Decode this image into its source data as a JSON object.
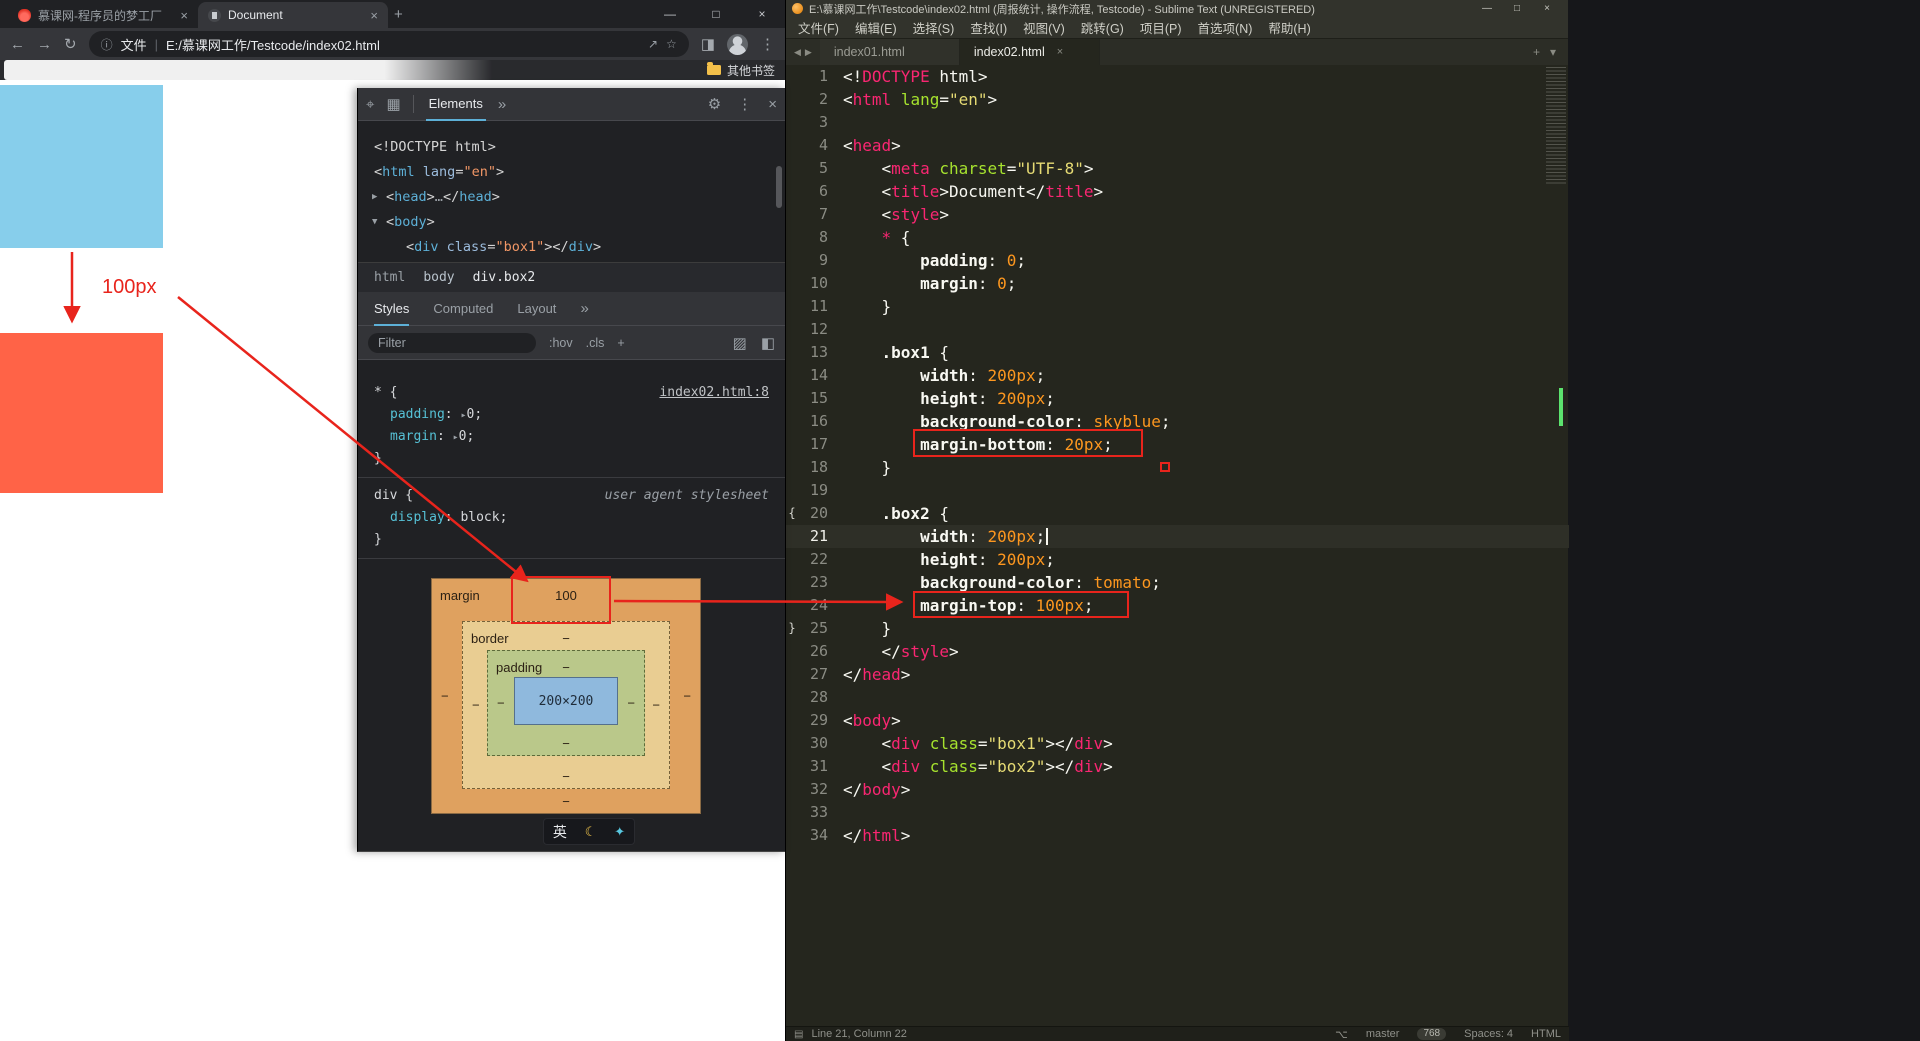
{
  "colors": {
    "annotation": "#e8241c",
    "box1": "#87ceeb",
    "box2": "#ff6347"
  },
  "icons": {
    "close": "×",
    "plus": "+",
    "min": "—",
    "max": "□",
    "back": "←",
    "forward": "→",
    "reload": "↻",
    "info": "ⓘ",
    "share": "↗",
    "star": "☆",
    "panel": "◨",
    "kebab": "⋮",
    "inspect": "⌖",
    "device": "▦",
    "more": "»",
    "gear": "⚙",
    "dock": "◧",
    "paint": "▨",
    "nav_left": "◀",
    "nav_right": "▶",
    "tab_more": "▾",
    "branch": "⌥",
    "grid": "▤",
    "moon": "☾",
    "pet": "✦",
    "divider": "|"
  },
  "browser": {
    "tabs": [
      {
        "title": "慕课网-程序员的梦工厂"
      },
      {
        "title": "Document"
      }
    ],
    "address": {
      "prefix": "文件",
      "url": "E:/慕课网工作/Testcode/index02.html"
    },
    "bookmarks_label": "其他书签"
  },
  "page": {
    "annotation_label": "100px"
  },
  "devtools": {
    "panel_tab": "Elements",
    "dom_lines": [
      {
        "ind": 16,
        "t": [
          [
            "<!DOCTYPE html>",
            "dpl"
          ]
        ]
      },
      {
        "ind": 16,
        "t": [
          [
            "<",
            "dpl"
          ],
          [
            "html",
            "dtag"
          ],
          [
            " ",
            "dpl"
          ],
          [
            "lang",
            "dattr"
          ],
          [
            "=",
            "dpl"
          ],
          [
            "\"en\"",
            "dval"
          ],
          [
            ">",
            "dpl"
          ]
        ]
      },
      {
        "ind": 28,
        "arrow": "▶",
        "t": [
          [
            "<",
            "dpl"
          ],
          [
            "head",
            "dtag"
          ],
          [
            ">",
            "dpl"
          ],
          [
            "…",
            "ddim"
          ],
          [
            "</",
            "dpl"
          ],
          [
            "head",
            "dtag"
          ],
          [
            ">",
            "dpl"
          ]
        ]
      },
      {
        "ind": 28,
        "arrow": "▼",
        "t": [
          [
            "<",
            "dpl"
          ],
          [
            "body",
            "dtag"
          ],
          [
            ">",
            "dpl"
          ]
        ]
      },
      {
        "ind": 48,
        "t": [
          [
            "<",
            "dpl"
          ],
          [
            "div",
            "dtag"
          ],
          [
            " ",
            "dpl"
          ],
          [
            "class",
            "dattr"
          ],
          [
            "=",
            "dpl"
          ],
          [
            "\"box1\"",
            "dval"
          ],
          [
            ">",
            "dpl"
          ],
          [
            "</",
            "dpl"
          ],
          [
            "div",
            "dtag"
          ],
          [
            ">",
            "dpl"
          ]
        ]
      }
    ],
    "breadcrumbs": [
      {
        "label": "html",
        "cls": "c-dim"
      },
      {
        "label": "body",
        "cls": "c-mid"
      },
      {
        "label": "div.box2",
        "cls": "c-sel"
      }
    ],
    "styles_tabs": [
      "Styles",
      "Computed",
      "Layout"
    ],
    "filter": {
      "placeholder": "Filter",
      "hov": ":hov",
      "cls": ".cls",
      "plus": "+"
    },
    "rules": [
      {
        "selector": "* {",
        "link": "index02.html:8",
        "props": [
          {
            "name": "padding",
            "tri": true,
            "value": "0"
          },
          {
            "name": "margin",
            "tri": true,
            "value": "0"
          }
        ],
        "close": "}"
      },
      {
        "selector": "div {",
        "origin": "user agent stylesheet",
        "props": [
          {
            "name": "display",
            "tri": false,
            "value": "block"
          }
        ],
        "close": "}"
      }
    ],
    "box_model": {
      "margin": "margin",
      "border": "border",
      "padding": "padding",
      "content": "200×200",
      "top_value": "100",
      "dash": "−"
    }
  },
  "ime": {
    "lang": "英"
  },
  "sublime": {
    "title": "E:\\慕课网工作\\Testcode\\index02.html (周报统计, 操作流程, Testcode) - Sublime Text (UNREGISTERED)",
    "menus": [
      "文件(F)",
      "编辑(E)",
      "选择(S)",
      "查找(I)",
      "视图(V)",
      "跳转(G)",
      "项目(P)",
      "首选项(N)",
      "帮助(H)"
    ],
    "tabs": [
      {
        "label": "index01.html",
        "active": false
      },
      {
        "label": "index02.html",
        "active": true
      }
    ],
    "status": {
      "line_info": "Line 21, Column 22",
      "branch": "master",
      "badge": "768",
      "spaces": "Spaces: 4",
      "syntax": "HTML"
    },
    "code_lines": [
      {
        "n": 1,
        "t": [
          [
            "<!",
            "pl"
          ],
          [
            "DOCTYPE",
            "tag"
          ],
          [
            " html",
            "pl"
          ],
          [
            ">",
            "pl"
          ]
        ]
      },
      {
        "n": 2,
        "t": [
          [
            "<",
            "pl"
          ],
          [
            "html",
            "tag"
          ],
          [
            " ",
            "pl"
          ],
          [
            "lang",
            "attr"
          ],
          [
            "=",
            "pl"
          ],
          [
            "\"en\"",
            "str"
          ],
          [
            ">",
            "pl"
          ]
        ]
      },
      {
        "n": 3,
        "t": []
      },
      {
        "n": 4,
        "t": [
          [
            "<",
            "pl"
          ],
          [
            "head",
            "tag"
          ],
          [
            ">",
            "pl"
          ]
        ]
      },
      {
        "n": 5,
        "t": [
          [
            "    <",
            "pl"
          ],
          [
            "meta",
            "tag"
          ],
          [
            " ",
            "pl"
          ],
          [
            "charset",
            "attr"
          ],
          [
            "=",
            "pl"
          ],
          [
            "\"UTF-8\"",
            "str"
          ],
          [
            ">",
            "pl"
          ]
        ]
      },
      {
        "n": 6,
        "t": [
          [
            "    <",
            "pl"
          ],
          [
            "title",
            "tag"
          ],
          [
            ">",
            "pl"
          ],
          [
            "Document",
            "pl"
          ],
          [
            "</",
            "pl"
          ],
          [
            "title",
            "tag"
          ],
          [
            ">",
            "pl"
          ]
        ]
      },
      {
        "n": 7,
        "t": [
          [
            "    <",
            "pl"
          ],
          [
            "style",
            "tag"
          ],
          [
            ">",
            "pl"
          ]
        ]
      },
      {
        "n": 8,
        "t": [
          [
            "    ",
            "pl"
          ],
          [
            "*",
            "tag"
          ],
          [
            " {",
            "pl"
          ]
        ]
      },
      {
        "n": 9,
        "t": [
          [
            "        ",
            "pl"
          ],
          [
            "padding",
            "prop"
          ],
          [
            ": ",
            "pl"
          ],
          [
            "0",
            "val"
          ],
          [
            ";",
            "pl"
          ]
        ]
      },
      {
        "n": 10,
        "t": [
          [
            "        ",
            "pl"
          ],
          [
            "margin",
            "prop"
          ],
          [
            ": ",
            "pl"
          ],
          [
            "0",
            "val"
          ],
          [
            ";",
            "pl"
          ]
        ]
      },
      {
        "n": 11,
        "t": [
          [
            "    }",
            "pl"
          ]
        ]
      },
      {
        "n": 12,
        "t": []
      },
      {
        "n": 13,
        "t": [
          [
            "    ",
            "pl"
          ],
          [
            ".box1",
            "sel"
          ],
          [
            " {",
            "pl"
          ]
        ]
      },
      {
        "n": 14,
        "t": [
          [
            "        ",
            "pl"
          ],
          [
            "width",
            "prop"
          ],
          [
            ": ",
            "pl"
          ],
          [
            "200px",
            "val"
          ],
          [
            ";",
            "pl"
          ]
        ]
      },
      {
        "n": 15,
        "t": [
          [
            "        ",
            "pl"
          ],
          [
            "height",
            "prop"
          ],
          [
            ": ",
            "pl"
          ],
          [
            "200px",
            "val"
          ],
          [
            ";",
            "pl"
          ]
        ]
      },
      {
        "n": 16,
        "t": [
          [
            "        ",
            "pl"
          ],
          [
            "background-color",
            "prop"
          ],
          [
            ": ",
            "pl"
          ],
          [
            "skyblue",
            "val"
          ],
          [
            ";",
            "pl"
          ]
        ]
      },
      {
        "n": 17,
        "t": [
          [
            "        ",
            "pl"
          ],
          [
            "margin-bottom",
            "prop"
          ],
          [
            ": ",
            "pl"
          ],
          [
            "20px",
            "val"
          ],
          [
            ";",
            "pl"
          ]
        ]
      },
      {
        "n": 18,
        "t": [
          [
            "    }",
            "pl"
          ]
        ]
      },
      {
        "n": 19,
        "t": []
      },
      {
        "n": 20,
        "gm": "{",
        "t": [
          [
            "    ",
            "pl"
          ],
          [
            ".box2",
            "sel"
          ],
          [
            " {",
            "pl"
          ]
        ]
      },
      {
        "n": 21,
        "cur": true,
        "caret": true,
        "t": [
          [
            "        ",
            "pl"
          ],
          [
            "width",
            "prop"
          ],
          [
            ": ",
            "pl"
          ],
          [
            "200px",
            "val"
          ],
          [
            ";",
            "pl"
          ]
        ]
      },
      {
        "n": 22,
        "t": [
          [
            "        ",
            "pl"
          ],
          [
            "height",
            "prop"
          ],
          [
            ": ",
            "pl"
          ],
          [
            "200px",
            "val"
          ],
          [
            ";",
            "pl"
          ]
        ]
      },
      {
        "n": 23,
        "t": [
          [
            "        ",
            "pl"
          ],
          [
            "background-color",
            "prop"
          ],
          [
            ": ",
            "pl"
          ],
          [
            "tomato",
            "val"
          ],
          [
            ";",
            "pl"
          ]
        ]
      },
      {
        "n": 24,
        "t": [
          [
            "        ",
            "pl"
          ],
          [
            "margin-top",
            "prop"
          ],
          [
            ": ",
            "pl"
          ],
          [
            "100px",
            "val"
          ],
          [
            ";",
            "pl"
          ]
        ]
      },
      {
        "n": 25,
        "gm": "}",
        "t": [
          [
            "    }",
            "pl"
          ]
        ]
      },
      {
        "n": 26,
        "t": [
          [
            "    </",
            "pl"
          ],
          [
            "style",
            "tag"
          ],
          [
            ">",
            "pl"
          ]
        ]
      },
      {
        "n": 27,
        "t": [
          [
            "</",
            "pl"
          ],
          [
            "head",
            "tag"
          ],
          [
            ">",
            "pl"
          ]
        ]
      },
      {
        "n": 28,
        "t": []
      },
      {
        "n": 29,
        "t": [
          [
            "<",
            "pl"
          ],
          [
            "body",
            "tag"
          ],
          [
            ">",
            "pl"
          ]
        ]
      },
      {
        "n": 30,
        "t": [
          [
            "    <",
            "pl"
          ],
          [
            "div",
            "tag"
          ],
          [
            " ",
            "pl"
          ],
          [
            "class",
            "attr"
          ],
          [
            "=",
            "pl"
          ],
          [
            "\"box1\"",
            "str"
          ],
          [
            ">",
            "pl"
          ],
          [
            "</",
            "pl"
          ],
          [
            "div",
            "tag"
          ],
          [
            ">",
            "pl"
          ]
        ]
      },
      {
        "n": 31,
        "t": [
          [
            "    <",
            "pl"
          ],
          [
            "div",
            "tag"
          ],
          [
            " ",
            "pl"
          ],
          [
            "class",
            "attr"
          ],
          [
            "=",
            "pl"
          ],
          [
            "\"box2\"",
            "str"
          ],
          [
            ">",
            "pl"
          ],
          [
            "</",
            "pl"
          ],
          [
            "div",
            "tag"
          ],
          [
            ">",
            "pl"
          ]
        ]
      },
      {
        "n": 32,
        "t": [
          [
            "</",
            "pl"
          ],
          [
            "body",
            "tag"
          ],
          [
            ">",
            "pl"
          ]
        ]
      },
      {
        "n": 33,
        "t": []
      },
      {
        "n": 34,
        "t": [
          [
            "</",
            "pl"
          ],
          [
            "html",
            "tag"
          ],
          [
            ">",
            "pl"
          ]
        ]
      }
    ]
  }
}
